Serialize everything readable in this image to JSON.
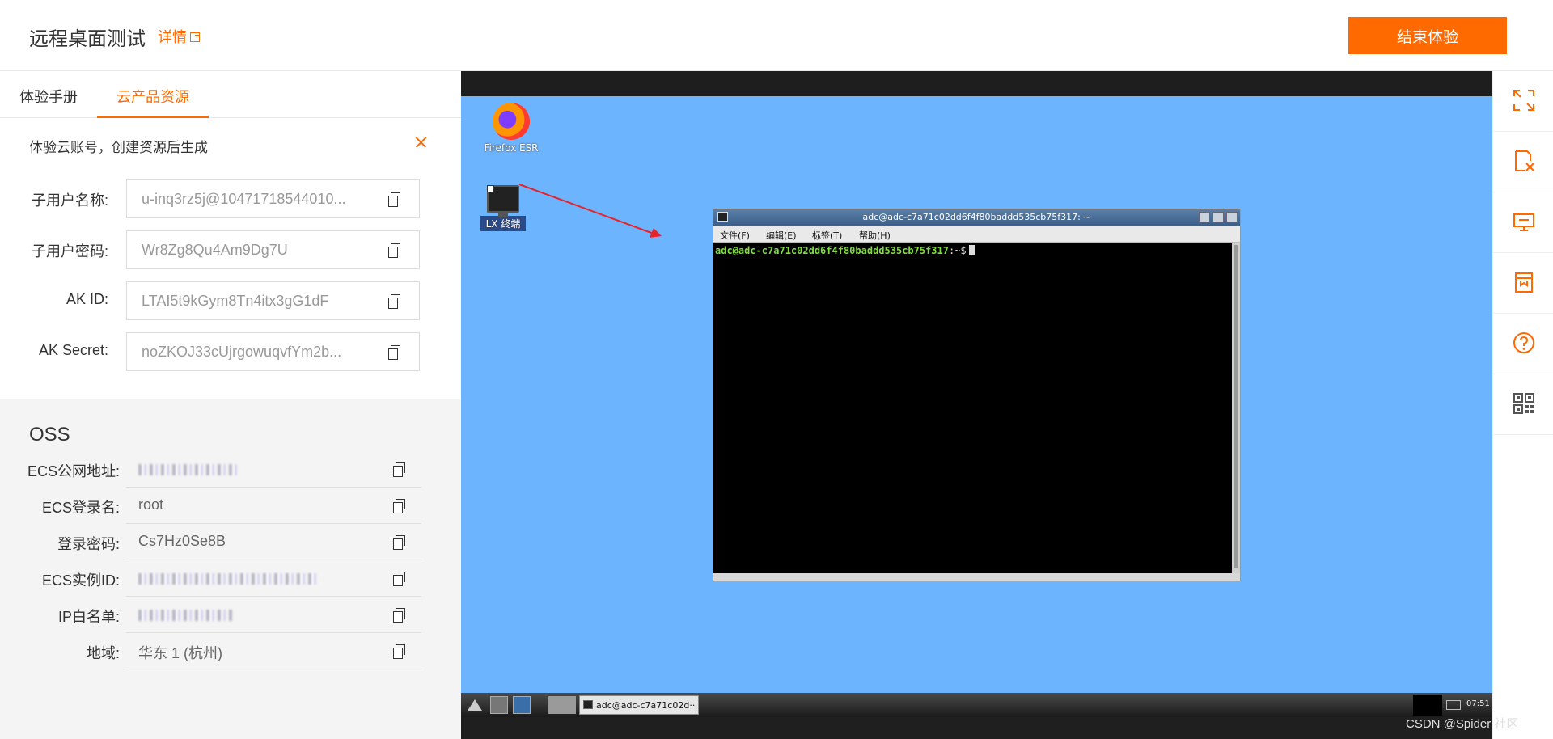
{
  "header": {
    "title": "远程桌面测试",
    "detail_link": "详情",
    "end_button": "结束体验"
  },
  "left_panel": {
    "tabs": [
      {
        "label": "体验手册",
        "active": false
      },
      {
        "label": "云产品资源",
        "active": true
      }
    ],
    "account_note": "体验云账号，创建资源后生成",
    "fields": [
      {
        "label": "子用户名称:",
        "value": "u-inq3rz5j@10471718544010..."
      },
      {
        "label": "子用户密码:",
        "value": "Wr8Zg8Qu4Am9Dg7U"
      },
      {
        "label": "AK ID:",
        "value": "LTAI5t9kGym8Tn4itx3gG1dF"
      },
      {
        "label": "AK Secret:",
        "value": "noZKOJ33cUjrgowuqvfYm2b..."
      }
    ],
    "oss": {
      "title": "OSS",
      "rows": [
        {
          "label": "ECS公网地址:",
          "value": "",
          "redacted": true
        },
        {
          "label": "ECS登录名:",
          "value": "root",
          "redacted": false
        },
        {
          "label": "登录密码:",
          "value": "Cs7Hz0Se8B",
          "redacted": false
        },
        {
          "label": "ECS实例ID:",
          "value": "",
          "redacted": true
        },
        {
          "label": "IP白名单:",
          "value": "",
          "redacted": true
        },
        {
          "label": "地域:",
          "value": "华东 1 (杭州)",
          "redacted": false
        }
      ]
    }
  },
  "desktop": {
    "icons": [
      {
        "label": "Firefox ESR",
        "icon": "firefox-icon"
      },
      {
        "label": "LX 终端",
        "icon": "terminal-icon"
      }
    ],
    "terminal": {
      "title": "adc@adc-c7a71c02dd6f4f80baddd535cb75f317: ~",
      "menu": [
        "文件(F)",
        "编辑(E)",
        "标签(T)",
        "帮助(H)"
      ],
      "prompt_user": "adc@adc-c7a71c02dd6f4f80baddd535cb75f317",
      "prompt_rest": ":~$"
    },
    "taskbar": {
      "task_label": "adc@adc-c7a71c02d···",
      "clock": "07:51"
    },
    "colors": {
      "desktop_bg": "#6db4ff",
      "accent": "#ff6a00",
      "annotation_arrow": "#e8232a"
    }
  },
  "tools": [
    "fullscreen-icon",
    "clipboard-icon",
    "display-icon",
    "bookmark-icon",
    "help-icon",
    "qrcode-icon"
  ],
  "watermark": "CSDN @Spider 社区"
}
